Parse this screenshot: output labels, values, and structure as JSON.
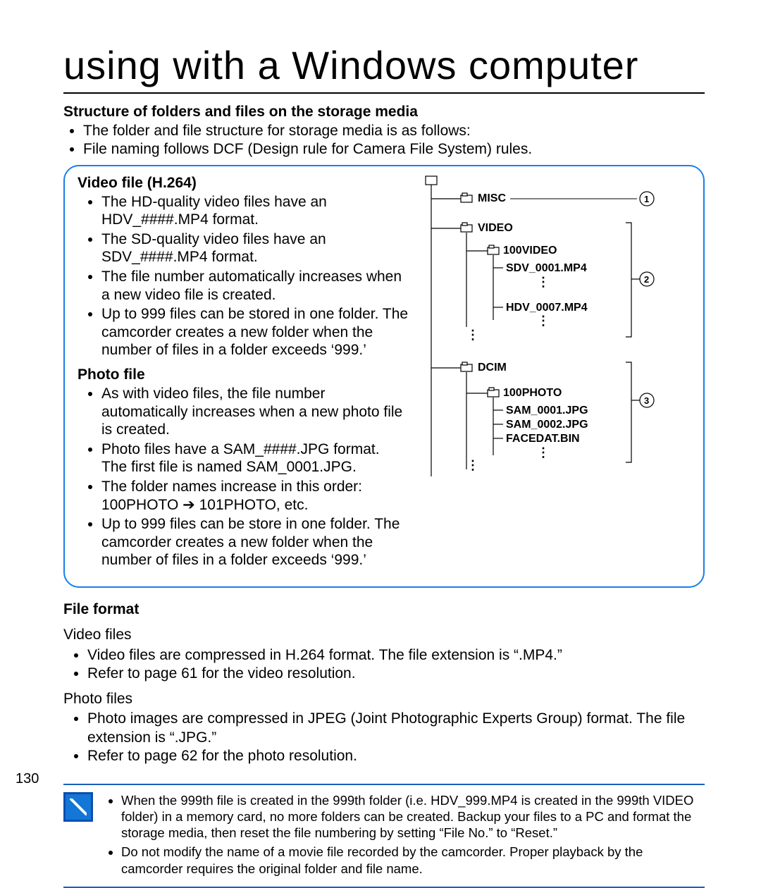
{
  "page": {
    "title": "using with a Windows computer",
    "number": "130"
  },
  "structure": {
    "heading": "Structure of folders and files on the storage media",
    "intro": [
      "The folder and file structure for storage media is as follows:",
      "File naming follows DCF (Design rule for Camera File System) rules."
    ]
  },
  "video_section": {
    "heading": "Video file (H.264)",
    "bullets": [
      "The HD-quality video files have an HDV_####.MP4 format.",
      "The SD-quality video files have an SDV_####.MP4 format.",
      "The file number automatically increases when a new video file is created.",
      "Up to 999 files can be stored in one folder. The camcorder creates a new folder when the number of files in a folder exceeds ‘999.’"
    ]
  },
  "photo_section": {
    "heading": "Photo file",
    "bullets": [
      "As with video files, the file number automatically increases when a new photo file is created.",
      "Photo files have a SAM_####.JPG format. The first file is named SAM_0001.JPG.",
      "The folder names increase in this order: 100PHOTO ➔ 101PHOTO, etc.",
      "Up to 999 files can be store in one folder. The camcorder creates a new folder when the number of files in a folder exceeds ‘999.’"
    ]
  },
  "diagram": {
    "labels": {
      "misc": "MISC",
      "video": "VIDEO",
      "video_folder": "100VIDEO",
      "sdv": "SDV_0001.MP4",
      "hdv": "HDV_0007.MP4",
      "dcim": "DCIM",
      "photo_folder": "100PHOTO",
      "sam1": "SAM_0001.JPG",
      "sam2": "SAM_0002.JPG",
      "facedat": "FACEDAT.BIN",
      "c1": "1",
      "c2": "2",
      "c3": "3"
    }
  },
  "file_format": {
    "heading": "File format",
    "video_sub": "Video files",
    "video_bullets": [
      "Video files are compressed in H.264 format. The file extension is “.MP4.”",
      "Refer to page 61 for the video resolution."
    ],
    "photo_sub": "Photo files",
    "photo_bullets": [
      "Photo images are compressed in JPEG (Joint Photographic Experts Group) format. The file extension is “.JPG.”",
      "Refer to page 62 for the photo resolution."
    ]
  },
  "note": {
    "items": [
      "When the 999th file is created in the 999th folder (i.e. HDV_999.MP4 is created in the 999th VIDEO folder) in a memory card, no more folders can be created. Backup your files to a PC and format the storage media, then reset the file numbering by setting “File No.” to “Reset.”",
      "Do not modify the name of a movie file recorded by the camcorder. Proper playback by the camcorder requires the original folder and file name."
    ],
    "bold_terms": {
      "file_no": "File No.",
      "reset": "Reset."
    }
  }
}
